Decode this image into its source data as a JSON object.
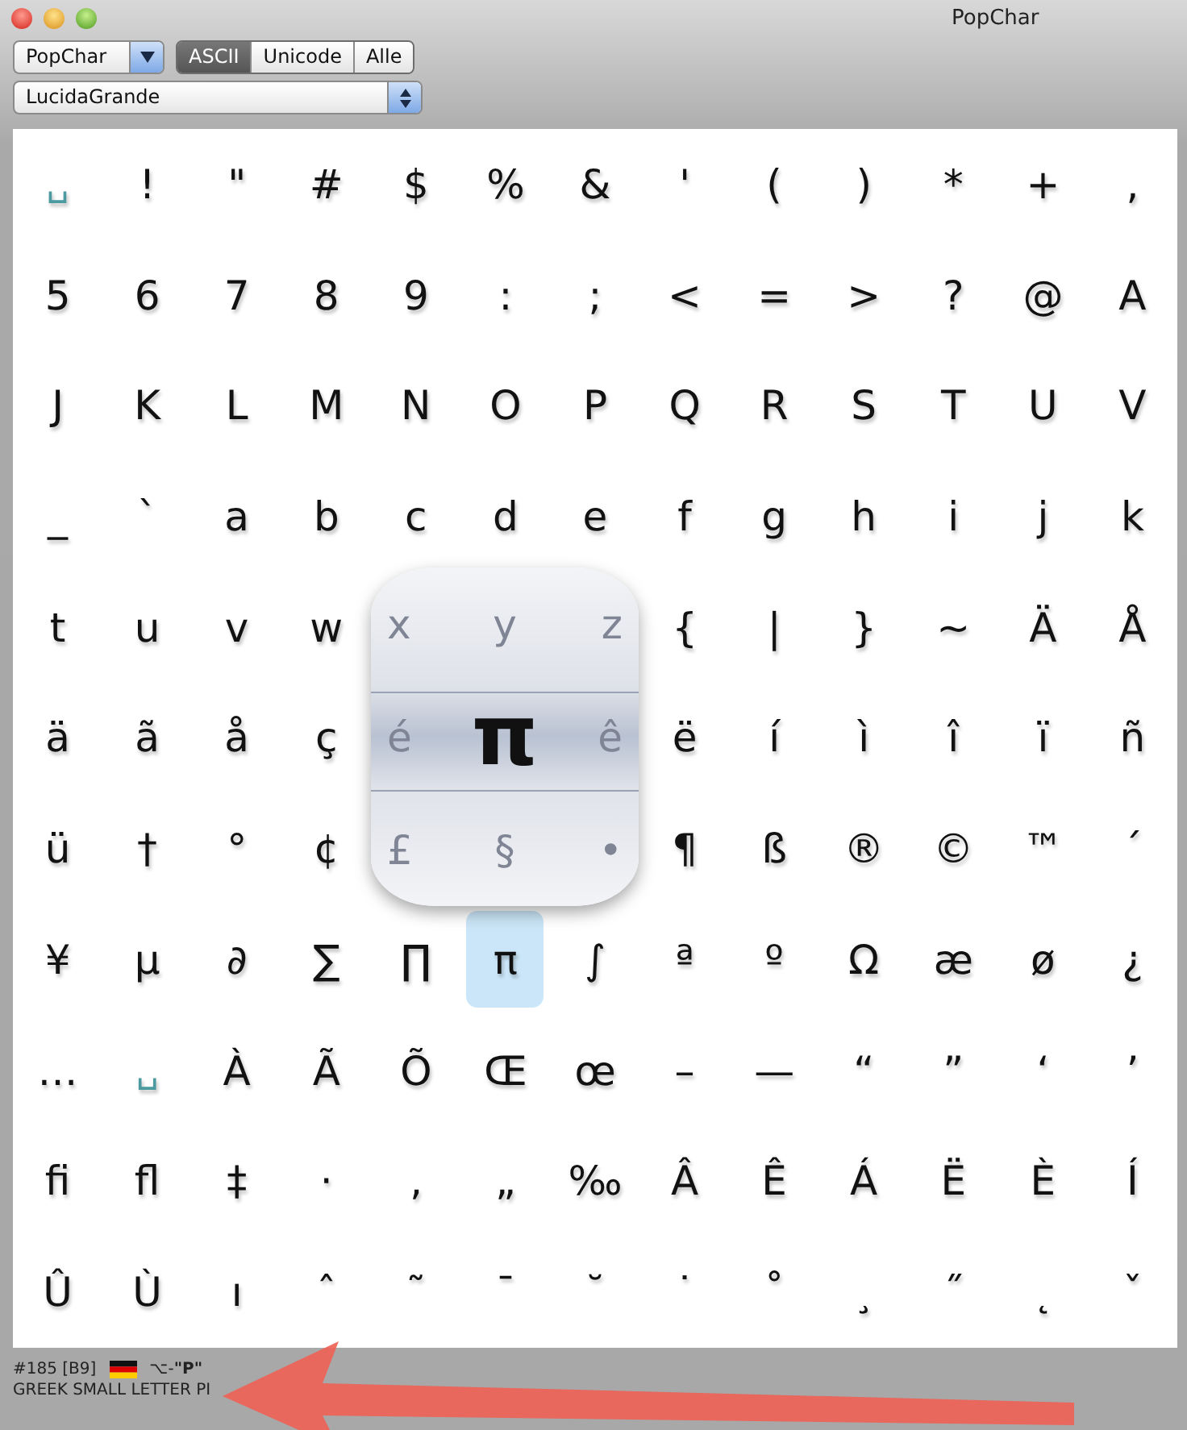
{
  "window": {
    "title": "PopChar"
  },
  "toolbar": {
    "menu": "PopChar",
    "segments": [
      {
        "label": "ASCII",
        "selected": true
      },
      {
        "label": "Unicode",
        "selected": false
      },
      {
        "label": "Alle",
        "selected": false
      }
    ],
    "font": "LucidaGrande"
  },
  "grid": {
    "rows": [
      [
        {
          "kind": "space",
          "char": "␣",
          "selected": false
        },
        {
          "kind": "char",
          "char": "!",
          "selected": false
        },
        {
          "kind": "char",
          "char": "\"",
          "selected": false
        },
        {
          "kind": "char",
          "char": "#",
          "selected": false
        },
        {
          "kind": "char",
          "char": "$",
          "selected": false
        },
        {
          "kind": "char",
          "char": "%",
          "selected": false
        },
        {
          "kind": "char",
          "char": "&",
          "selected": false
        },
        {
          "kind": "char",
          "char": "'",
          "selected": false
        },
        {
          "kind": "char",
          "char": "(",
          "selected": false
        },
        {
          "kind": "char",
          "char": ")",
          "selected": false
        },
        {
          "kind": "char",
          "char": "*",
          "selected": false
        },
        {
          "kind": "char",
          "char": "+",
          "selected": false
        },
        {
          "kind": "char",
          "char": ",",
          "selected": false
        }
      ],
      [
        {
          "kind": "char",
          "char": "5",
          "selected": false
        },
        {
          "kind": "char",
          "char": "6",
          "selected": false
        },
        {
          "kind": "char",
          "char": "7",
          "selected": false
        },
        {
          "kind": "char",
          "char": "8",
          "selected": false
        },
        {
          "kind": "char",
          "char": "9",
          "selected": false
        },
        {
          "kind": "char",
          "char": ":",
          "selected": false
        },
        {
          "kind": "char",
          "char": ";",
          "selected": false
        },
        {
          "kind": "char",
          "char": "<",
          "selected": false
        },
        {
          "kind": "char",
          "char": "=",
          "selected": false
        },
        {
          "kind": "char",
          "char": ">",
          "selected": false
        },
        {
          "kind": "char",
          "char": "?",
          "selected": false
        },
        {
          "kind": "char",
          "char": "@",
          "selected": false
        },
        {
          "kind": "char",
          "char": "A",
          "selected": false
        }
      ],
      [
        {
          "kind": "char",
          "char": "J",
          "selected": false
        },
        {
          "kind": "char",
          "char": "K",
          "selected": false
        },
        {
          "kind": "char",
          "char": "L",
          "selected": false
        },
        {
          "kind": "char",
          "char": "M",
          "selected": false
        },
        {
          "kind": "char",
          "char": "N",
          "selected": false
        },
        {
          "kind": "char",
          "char": "O",
          "selected": false
        },
        {
          "kind": "char",
          "char": "P",
          "selected": false
        },
        {
          "kind": "char",
          "char": "Q",
          "selected": false
        },
        {
          "kind": "char",
          "char": "R",
          "selected": false
        },
        {
          "kind": "char",
          "char": "S",
          "selected": false
        },
        {
          "kind": "char",
          "char": "T",
          "selected": false
        },
        {
          "kind": "char",
          "char": "U",
          "selected": false
        },
        {
          "kind": "char",
          "char": "V",
          "selected": false
        }
      ],
      [
        {
          "kind": "char",
          "char": "_",
          "selected": false
        },
        {
          "kind": "char",
          "char": "`",
          "selected": false
        },
        {
          "kind": "char",
          "char": "a",
          "selected": false
        },
        {
          "kind": "char",
          "char": "b",
          "selected": false
        },
        {
          "kind": "char",
          "char": "c",
          "selected": false
        },
        {
          "kind": "char",
          "char": "d",
          "selected": false
        },
        {
          "kind": "char",
          "char": "e",
          "selected": false
        },
        {
          "kind": "char",
          "char": "f",
          "selected": false
        },
        {
          "kind": "char",
          "char": "g",
          "selected": false
        },
        {
          "kind": "char",
          "char": "h",
          "selected": false
        },
        {
          "kind": "char",
          "char": "i",
          "selected": false
        },
        {
          "kind": "char",
          "char": "j",
          "selected": false
        },
        {
          "kind": "char",
          "char": "k",
          "selected": false
        }
      ],
      [
        {
          "kind": "char",
          "char": "t",
          "selected": false
        },
        {
          "kind": "char",
          "char": "u",
          "selected": false
        },
        {
          "kind": "char",
          "char": "v",
          "selected": false
        },
        {
          "kind": "char",
          "char": "w",
          "selected": false
        },
        {
          "kind": "covered"
        },
        {
          "kind": "covered"
        },
        {
          "kind": "covered"
        },
        {
          "kind": "char",
          "char": "{",
          "selected": false
        },
        {
          "kind": "char",
          "char": "|",
          "selected": false
        },
        {
          "kind": "char",
          "char": "}",
          "selected": false
        },
        {
          "kind": "char",
          "char": "~",
          "selected": false
        },
        {
          "kind": "char",
          "char": "Ä",
          "selected": false
        },
        {
          "kind": "char",
          "char": "Å",
          "selected": false
        }
      ],
      [
        {
          "kind": "char",
          "char": "ä",
          "selected": false
        },
        {
          "kind": "char",
          "char": "ã",
          "selected": false
        },
        {
          "kind": "char",
          "char": "å",
          "selected": false
        },
        {
          "kind": "char",
          "char": "ç",
          "selected": false
        },
        {
          "kind": "covered"
        },
        {
          "kind": "covered"
        },
        {
          "kind": "covered"
        },
        {
          "kind": "char",
          "char": "ë",
          "selected": false
        },
        {
          "kind": "char",
          "char": "í",
          "selected": false
        },
        {
          "kind": "char",
          "char": "ì",
          "selected": false
        },
        {
          "kind": "char",
          "char": "î",
          "selected": false
        },
        {
          "kind": "char",
          "char": "ï",
          "selected": false
        },
        {
          "kind": "char",
          "char": "ñ",
          "selected": false
        }
      ],
      [
        {
          "kind": "char",
          "char": "ü",
          "selected": false
        },
        {
          "kind": "char",
          "char": "†",
          "selected": false
        },
        {
          "kind": "char",
          "char": "°",
          "selected": false
        },
        {
          "kind": "char",
          "char": "¢",
          "selected": false
        },
        {
          "kind": "covered"
        },
        {
          "kind": "covered"
        },
        {
          "kind": "covered"
        },
        {
          "kind": "char",
          "char": "¶",
          "selected": false
        },
        {
          "kind": "char",
          "char": "ß",
          "selected": false
        },
        {
          "kind": "char",
          "char": "®",
          "selected": false
        },
        {
          "kind": "char",
          "char": "©",
          "selected": false
        },
        {
          "kind": "char",
          "char": "™",
          "selected": false
        },
        {
          "kind": "char",
          "char": "´",
          "selected": false
        }
      ],
      [
        {
          "kind": "char",
          "char": "¥",
          "selected": false
        },
        {
          "kind": "char",
          "char": "µ",
          "selected": false
        },
        {
          "kind": "char",
          "char": "∂",
          "selected": false
        },
        {
          "kind": "char",
          "char": "∑",
          "selected": false
        },
        {
          "kind": "char",
          "char": "∏",
          "selected": false
        },
        {
          "kind": "char",
          "char": "π",
          "selected": true
        },
        {
          "kind": "char",
          "char": "∫",
          "selected": false
        },
        {
          "kind": "char",
          "char": "ª",
          "selected": false
        },
        {
          "kind": "char",
          "char": "º",
          "selected": false
        },
        {
          "kind": "char",
          "char": "Ω",
          "selected": false
        },
        {
          "kind": "char",
          "char": "æ",
          "selected": false
        },
        {
          "kind": "char",
          "char": "ø",
          "selected": false
        },
        {
          "kind": "char",
          "char": "¿",
          "selected": false
        }
      ],
      [
        {
          "kind": "char",
          "char": "…",
          "selected": false
        },
        {
          "kind": "space",
          "char": "␣",
          "selected": false
        },
        {
          "kind": "char",
          "char": "À",
          "selected": false
        },
        {
          "kind": "char",
          "char": "Ã",
          "selected": false
        },
        {
          "kind": "char",
          "char": "Õ",
          "selected": false
        },
        {
          "kind": "char",
          "char": "Œ",
          "selected": false
        },
        {
          "kind": "char",
          "char": "œ",
          "selected": false
        },
        {
          "kind": "char",
          "char": "–",
          "selected": false
        },
        {
          "kind": "char",
          "char": "—",
          "selected": false
        },
        {
          "kind": "char",
          "char": "“",
          "selected": false
        },
        {
          "kind": "char",
          "char": "”",
          "selected": false
        },
        {
          "kind": "char",
          "char": "‘",
          "selected": false
        },
        {
          "kind": "char",
          "char": "’",
          "selected": false
        }
      ],
      [
        {
          "kind": "char",
          "char": "ﬁ",
          "selected": false
        },
        {
          "kind": "char",
          "char": "ﬂ",
          "selected": false
        },
        {
          "kind": "char",
          "char": "‡",
          "selected": false
        },
        {
          "kind": "char",
          "char": "·",
          "selected": false
        },
        {
          "kind": "char",
          "char": "‚",
          "selected": false
        },
        {
          "kind": "char",
          "char": "„",
          "selected": false
        },
        {
          "kind": "char",
          "char": "‰",
          "selected": false
        },
        {
          "kind": "char",
          "char": "Â",
          "selected": false
        },
        {
          "kind": "char",
          "char": "Ê",
          "selected": false
        },
        {
          "kind": "char",
          "char": "Á",
          "selected": false
        },
        {
          "kind": "char",
          "char": "Ë",
          "selected": false
        },
        {
          "kind": "char",
          "char": "È",
          "selected": false
        },
        {
          "kind": "char",
          "char": "Í",
          "selected": false
        }
      ],
      [
        {
          "kind": "char",
          "char": "Û",
          "selected": false
        },
        {
          "kind": "char",
          "char": "Ù",
          "selected": false
        },
        {
          "kind": "char",
          "char": "ı",
          "selected": false
        },
        {
          "kind": "char",
          "char": "ˆ",
          "selected": false
        },
        {
          "kind": "char",
          "char": "˜",
          "selected": false
        },
        {
          "kind": "char",
          "char": "¯",
          "selected": false
        },
        {
          "kind": "char",
          "char": "˘",
          "selected": false
        },
        {
          "kind": "char",
          "char": "˙",
          "selected": false
        },
        {
          "kind": "char",
          "char": "˚",
          "selected": false
        },
        {
          "kind": "char",
          "char": "¸",
          "selected": false
        },
        {
          "kind": "char",
          "char": "˝",
          "selected": false
        },
        {
          "kind": "char",
          "char": "˛",
          "selected": false
        },
        {
          "kind": "char",
          "char": "ˇ",
          "selected": false
        }
      ]
    ]
  },
  "magnifier": {
    "glyph": "π",
    "ghost_rows": [
      {
        "left": "x",
        "center": "y",
        "right": "z"
      },
      {
        "left": "é",
        "right": "ê"
      },
      {
        "left": "£",
        "center": "§",
        "right": "•"
      }
    ]
  },
  "status_bar": {
    "code": "#185 [B9]",
    "shortcut": "⌥-**\"P\"**",
    "name": "GREEK SMALL LETTER PI"
  }
}
